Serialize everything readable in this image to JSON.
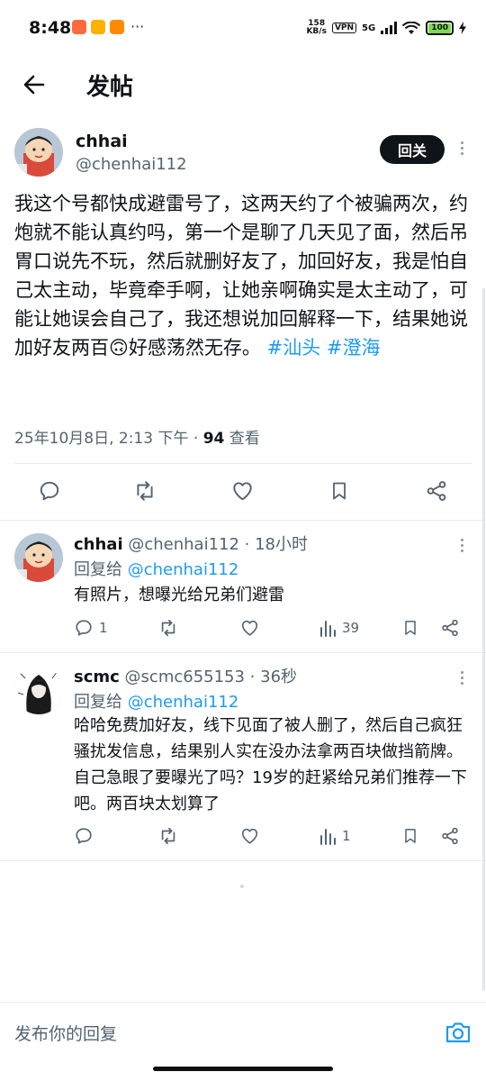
{
  "status_bar": {
    "time": "8:48",
    "network_speed_value": "158",
    "network_speed_unit": "KB/s",
    "vpn": "VPN",
    "network_type": "5G",
    "battery": "100",
    "more": "···"
  },
  "header": {
    "title": "发帖"
  },
  "main_tweet": {
    "name": "chhai",
    "handle": "@chenhai112",
    "follow_label": "回关",
    "text": "我这个号都快成避雷号了，这两天约了个被骗两次，约炮就不能认真约吗，第一个是聊了几天见了面，然后吊胃口说先不玩，然后就删好友了，加回好友，我是怕自己太主动，毕竟牵手啊，让她亲啊确实是太主动了，可能让她误会自己了，我还想说加回解释一下，结果她说加好友两百🙃好感荡然无存。",
    "hashtags": [
      "#汕头",
      "#澄海"
    ],
    "timestamp": "25年10月8日, 2:13 下午 · ",
    "views_count": "94",
    "views_label": " 查看"
  },
  "replies": [
    {
      "name": "chhai",
      "handle": "@chenhai112 · 18小时",
      "reply_to_label": "回复给 ",
      "reply_to_handle": "@chenhai112",
      "text": "有照片，想曝光给兄弟们避雷",
      "reply_count": "1",
      "view_count": "39"
    },
    {
      "name": "scmc",
      "handle": "@scmc655153 · 36秒",
      "reply_to_label": "回复给 ",
      "reply_to_handle": "@chenhai112",
      "text": "哈哈免费加好友，线下见面了被人删了，然后自己疯狂骚扰发信息，结果别人实在没办法拿两百块做挡箭牌。自己急眼了要曝光了吗？19岁的赶紧给兄弟们推荐一下吧。两百块太划算了",
      "reply_count": "",
      "view_count": "1"
    }
  ],
  "composer": {
    "placeholder": "发布你的回复"
  },
  "icons": {
    "back": "arrow-left-icon",
    "reply": "comment-icon",
    "repost": "repost-icon",
    "like": "heart-icon",
    "bookmark": "bookmark-icon",
    "share": "share-icon",
    "views": "bar-chart-icon",
    "camera": "camera-icon"
  },
  "colors": {
    "accent": "#1d9bf0",
    "text_primary": "#0f1419",
    "text_secondary": "#536471",
    "follow_button_bg": "#0f1419"
  }
}
